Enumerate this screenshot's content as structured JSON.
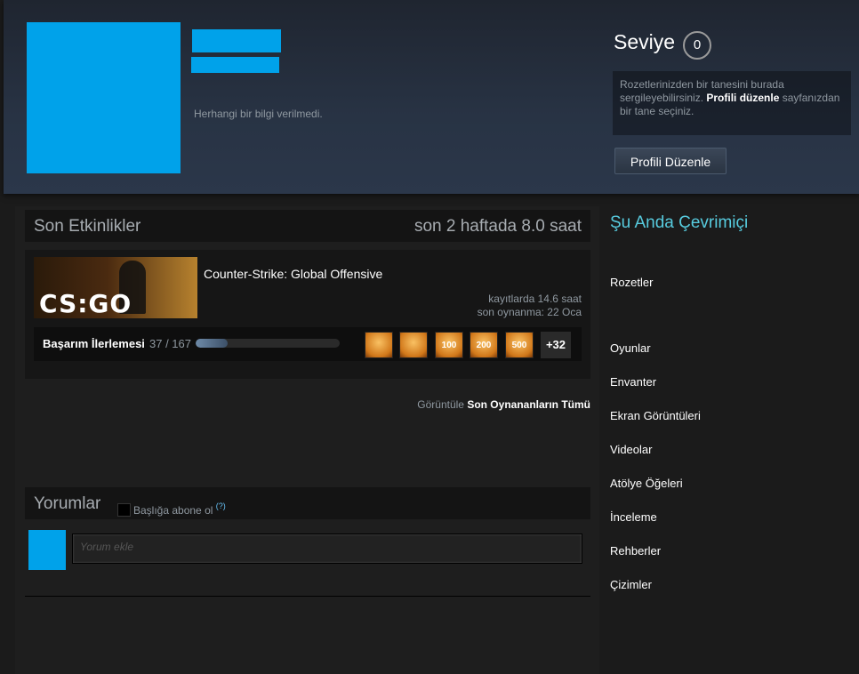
{
  "profile": {
    "no_info": "Herhangi bir bilgi verilmedi.",
    "level_label": "Seviye",
    "level_value": "0",
    "badge_text_1": "Rozetlerinizden bir tanesini burada sergileyebilirsiniz.",
    "badge_link": "Profili düzenle",
    "badge_text_2": "sayfanızdan bir tane seçiniz.",
    "edit_button": "Profili Düzenle",
    "accent_color": "#00a2ea"
  },
  "activity": {
    "title": "Son Etkinlikler",
    "hours_recent": "son 2 haftada 8.0 saat",
    "game": {
      "capsule_text": "CS:GO",
      "name": "Counter-Strike: Global Offensive",
      "hours_total": "kayıtlarda 14.6 saat",
      "last_played": "son oynanma: 22 Oca",
      "achievements_label": "Başarım İlerlemesi",
      "achievements_count": "37 / 167",
      "achievements_progress": 0.22,
      "achievement_icons": [
        "target-icon",
        "runner-icon",
        "100",
        "200",
        "500"
      ],
      "more_count": "+32"
    },
    "view_prefix": "Görüntüle",
    "view_all": "Son Oynananların Tümü"
  },
  "comments": {
    "title": "Yorumlar",
    "subscribe_label": "Başlığa abone ol",
    "help_mark": "(?)",
    "placeholder": "Yorum ekle"
  },
  "sidebar": {
    "online_status": "Şu Anda Çevrimiçi",
    "badges": "Rozetler",
    "links": [
      "Oyunlar",
      "Envanter",
      "Ekran Görüntüleri",
      "Videolar",
      "Atölye Öğeleri",
      "İnceleme",
      "Rehberler",
      "Çizimler"
    ]
  }
}
